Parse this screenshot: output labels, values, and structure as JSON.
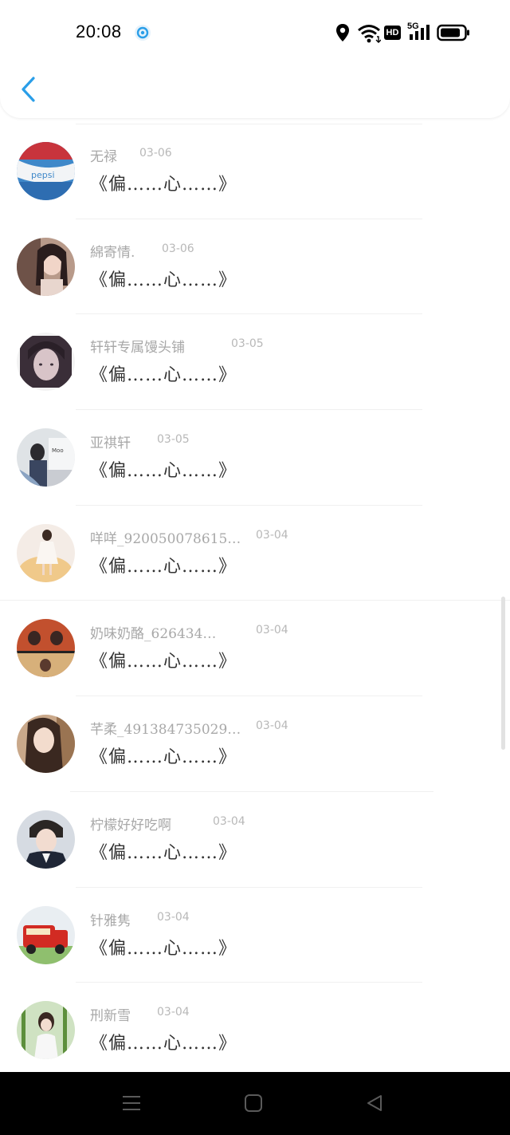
{
  "status_bar": {
    "time": "20:08",
    "network": "5G",
    "hd": "HD"
  },
  "header": {
    "back_icon": "chevron-left-icon"
  },
  "colors": {
    "accent": "#2a9ee8",
    "name_text": "#a8a8a8",
    "message_text": "#333333",
    "nav_bar": "#000000"
  },
  "messages": [
    {
      "name": "无禄",
      "date": "03-06",
      "text": "《偏……心……》",
      "avatar": "pepsi-avatar"
    },
    {
      "name": "綿寄情.",
      "date": "03-06",
      "text": "《偏……心……》",
      "avatar": "girl-avatar"
    },
    {
      "name": "轩轩专属馒头铺",
      "date": "03-05",
      "text": "《偏……心……》",
      "avatar": "portrait-avatar"
    },
    {
      "name": "亚祺轩",
      "date": "03-05",
      "text": "《偏……心……》",
      "avatar": "photo-avatar"
    },
    {
      "name": "咩咩_920050078615…",
      "date": "03-04",
      "text": "《偏……心……》",
      "avatar": "dress-avatar"
    },
    {
      "name": "奶味奶酪_626434…",
      "date": "03-04",
      "text": "《偏……心……》",
      "avatar": "anime-avatar"
    },
    {
      "name": "芊柔_491384735029…",
      "date": "03-04",
      "text": "《偏……心……》",
      "avatar": "longhair-avatar"
    },
    {
      "name": "柠檬好好吃啊",
      "date": "03-04",
      "text": "《偏……心……》",
      "avatar": "suit-avatar"
    },
    {
      "name": "针雅隽",
      "date": "03-04",
      "text": "《偏……心……》",
      "avatar": "firetruck-avatar"
    },
    {
      "name": "刑新雪",
      "date": "03-04",
      "text": "《偏……心……》",
      "avatar": "bamboo-avatar"
    }
  ],
  "nav": {
    "menu_icon": "menu-icon",
    "home_icon": "home-icon",
    "back_icon": "back-triangle-icon"
  }
}
